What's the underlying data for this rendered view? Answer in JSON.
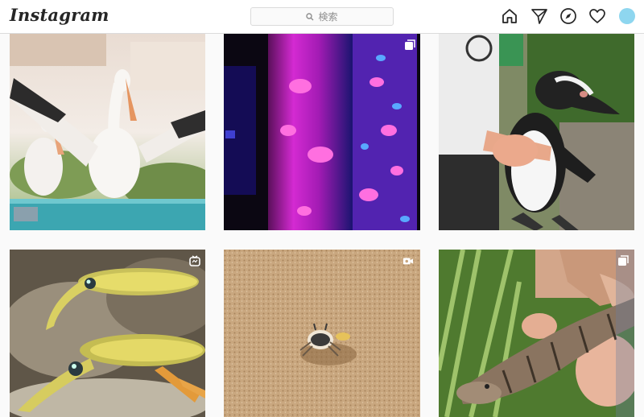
{
  "app": {
    "logo_text": "Instagram"
  },
  "search": {
    "placeholder": "検索"
  },
  "nav": {
    "icons": [
      "home-icon",
      "direct-icon",
      "explore-icon",
      "activity-icon",
      "profile-avatar"
    ]
  },
  "colors": {
    "avatar": "#8ed6ef",
    "accent": "#262626"
  },
  "posts": [
    {
      "subject": "pelicans",
      "badge": "none"
    },
    {
      "subject": "jellyfish",
      "badge": "carousel-icon"
    },
    {
      "subject": "penguin",
      "badge": "none"
    },
    {
      "subject": "squid",
      "badge": "igtv-icon"
    },
    {
      "subject": "crab",
      "badge": "video-icon"
    },
    {
      "subject": "lizard",
      "badge": "carousel-icon"
    }
  ]
}
